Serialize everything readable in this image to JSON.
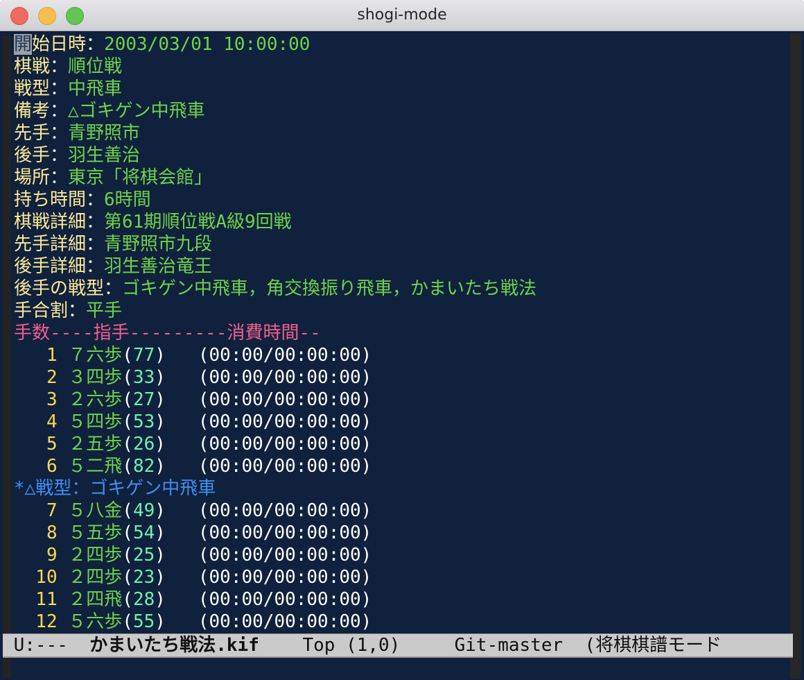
{
  "window": {
    "title": "shogi-mode"
  },
  "headers": [
    {
      "key": "開始日時",
      "value": "2003/03/01 10:00:00"
    },
    {
      "key": "棋戦",
      "value": "順位戦"
    },
    {
      "key": "戦型",
      "value": "中飛車"
    },
    {
      "key": "備考",
      "value": "△ゴキゲン中飛車"
    },
    {
      "key": "先手",
      "value": "青野照市"
    },
    {
      "key": "後手",
      "value": "羽生善治"
    },
    {
      "key": "場所",
      "value": "東京「将棋会館」"
    },
    {
      "key": "持ち時間",
      "value": "6時間"
    },
    {
      "key": "棋戦詳細",
      "value": "第61期順位戦A級9回戦"
    },
    {
      "key": "先手詳細",
      "value": "青野照市九段"
    },
    {
      "key": "後手詳細",
      "value": "羽生善治竜王"
    },
    {
      "key": "後手の戦型",
      "value": "ゴキゲン中飛車，角交換振り飛車，かまいたち戦法"
    },
    {
      "key": "手合割",
      "value": "平手"
    }
  ],
  "separator": "：",
  "cursor_char": "開",
  "table_header": "手数----指手---------消費時間--",
  "moves_a": [
    {
      "num": "   1",
      "move": " ７六歩",
      "from": "77",
      "time": "(00:00/00:00:00)"
    },
    {
      "num": "   2",
      "move": " ３四歩",
      "from": "33",
      "time": "(00:00/00:00:00)"
    },
    {
      "num": "   3",
      "move": " ２六歩",
      "from": "27",
      "time": "(00:00/00:00:00)"
    },
    {
      "num": "   4",
      "move": " ５四歩",
      "from": "53",
      "time": "(00:00/00:00:00)"
    },
    {
      "num": "   5",
      "move": " ２五歩",
      "from": "26",
      "time": "(00:00/00:00:00)"
    },
    {
      "num": "   6",
      "move": " ５二飛",
      "from": "82",
      "time": "(00:00/00:00:00)"
    }
  ],
  "comment": "*△戦型：ゴキゲン中飛車",
  "moves_b": [
    {
      "num": "   7",
      "move": " ５八金",
      "from": "49",
      "time": "(00:00/00:00:00)"
    },
    {
      "num": "   8",
      "move": " ５五歩",
      "from": "54",
      "time": "(00:00/00:00:00)"
    },
    {
      "num": "   9",
      "move": " ２四歩",
      "from": "25",
      "time": "(00:00/00:00:00)"
    },
    {
      "num": "  10",
      "move": " ２四歩",
      "from": "23",
      "time": "(00:00/00:00:00)"
    },
    {
      "num": "  11",
      "move": " ２四飛",
      "from": "28",
      "time": "(00:00/00:00:00)"
    },
    {
      "num": "  12",
      "move": " ５六歩",
      "from": "55",
      "time": "(00:00/00:00:00)"
    }
  ],
  "modeline": {
    "status": " U:---  ",
    "filename": "かまいたち戦法.kif",
    "position": "    Top (1,0)     ",
    "vc": "Git-master  ",
    "mode": "(将棋棋譜モード"
  }
}
